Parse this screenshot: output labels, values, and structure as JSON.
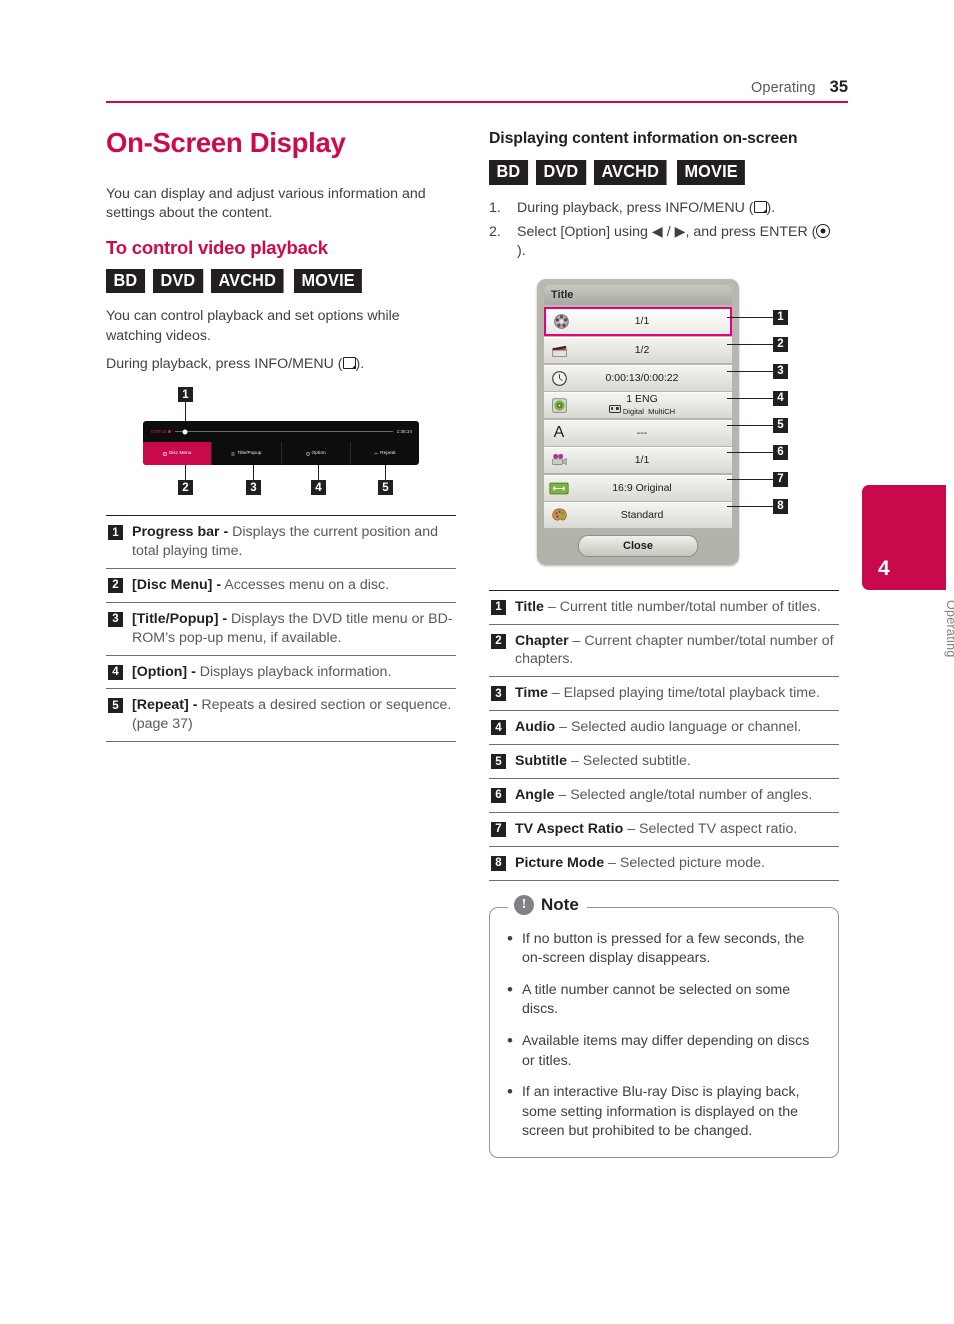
{
  "header": {
    "section": "Operating",
    "page_number": "35"
  },
  "left": {
    "title": "On-Screen Display",
    "intro": "You can display and adjust various information and settings about the content.",
    "section_heading": "To control video playback",
    "badges": [
      "BD",
      "DVD",
      "AVCHD",
      "MOVIE"
    ],
    "para1": "You can control playback and set options while watching videos.",
    "para2_pre": "During playback, press INFO/MENU (",
    "para2_post": ").",
    "player_figure": {
      "time_elapsed": "0:00:03",
      "time_total": "1:38:34",
      "buttons": [
        {
          "label": "Disc Menu",
          "icon": "disc-icon",
          "active": true
        },
        {
          "label": "Title/Popup",
          "icon": "list-icon",
          "active": false
        },
        {
          "label": "Option",
          "icon": "gear-icon",
          "active": false
        },
        {
          "label": "Repeat",
          "icon": "repeat-icon",
          "active": false
        }
      ],
      "callouts": [
        "1",
        "2",
        "3",
        "4",
        "5"
      ]
    },
    "definitions": [
      {
        "n": "1",
        "term": "Progress bar -",
        "desc": " Displays the current position and total playing time."
      },
      {
        "n": "2",
        "term": "[Disc Menu] -",
        "desc": " Accesses menu on a disc."
      },
      {
        "n": "3",
        "term": "[Title/Popup] -",
        "desc": " Displays the DVD title menu or BD-ROM’s pop-up menu, if available."
      },
      {
        "n": "4",
        "term": "[Option] -",
        "desc": " Displays playback information."
      },
      {
        "n": "5",
        "term": "[Repeat] -",
        "desc": " Repeats a desired section or sequence. (page 37)"
      }
    ]
  },
  "right": {
    "section_heading": "Displaying content information on-screen",
    "badges": [
      "BD",
      "DVD",
      "AVCHD",
      "MOVIE"
    ],
    "steps": [
      {
        "n": "1.",
        "pre": "During playback, press INFO/MENU (",
        "post": ").",
        "glyph": "info-menu-key-icon"
      },
      {
        "n": "2.",
        "pre": "Select [Option] using ◀ / ▶, and press ENTER (",
        "post": ").",
        "glyph": "enter-key-icon"
      }
    ],
    "osd": {
      "header_label": "Title",
      "close_label": "Close",
      "rows": [
        {
          "callout": "1",
          "icon": "film-reel-icon",
          "value": "1/1",
          "selected": true
        },
        {
          "callout": "2",
          "icon": "clapperboard-icon",
          "value": "1/2",
          "selected": false
        },
        {
          "callout": "3",
          "icon": "clock-icon",
          "value": "0:00:13/0:00:22",
          "selected": false
        },
        {
          "callout": "4",
          "icon": "speaker-icon",
          "value": "1 ENG",
          "sub_logo": "Digital",
          "sub_value": "MultiCH",
          "selected": false
        },
        {
          "callout": "5",
          "icon": "letter-a-icon",
          "value": "---",
          "selected": false
        },
        {
          "callout": "6",
          "icon": "camera-icon",
          "value": "1/1",
          "selected": false
        },
        {
          "callout": "7",
          "icon": "aspect-ratio-icon",
          "value": "16:9 Original",
          "selected": false
        },
        {
          "callout": "8",
          "icon": "palette-icon",
          "value": "Standard",
          "selected": false
        }
      ]
    },
    "definitions": [
      {
        "n": "1",
        "term": "Title",
        "desc": " – Current title number/total number of titles."
      },
      {
        "n": "2",
        "term": "Chapter",
        "desc": " – Current chapter number/total number of chapters."
      },
      {
        "n": "3",
        "term": "Time",
        "desc": " – Elapsed playing time/total playback time."
      },
      {
        "n": "4",
        "term": "Audio",
        "desc": " – Selected audio language or channel."
      },
      {
        "n": "5",
        "term": "Subtitle",
        "desc": " – Selected subtitle."
      },
      {
        "n": "6",
        "term": "Angle",
        "desc": " – Selected angle/total number of angles."
      },
      {
        "n": "7",
        "term": "TV Aspect Ratio",
        "desc": " – Selected TV aspect ratio."
      },
      {
        "n": "8",
        "term": "Picture Mode",
        "desc": " – Selected picture mode."
      }
    ],
    "note": {
      "title": "Note",
      "items": [
        "If no button is pressed for a few seconds, the on-screen display disappears.",
        "A title number cannot be selected on some discs.",
        "Available items may differ depending on discs or titles.",
        "If an interactive Blu-ray Disc is playing back, some setting information is displayed on the screen but prohibited to be changed."
      ]
    }
  },
  "side_tab": {
    "number": "4",
    "label": "Operating"
  },
  "colors": {
    "accent": "#C8094B",
    "heading": "#CF0A4C",
    "osd_select": "#E5007E",
    "body_text": "#404040"
  }
}
